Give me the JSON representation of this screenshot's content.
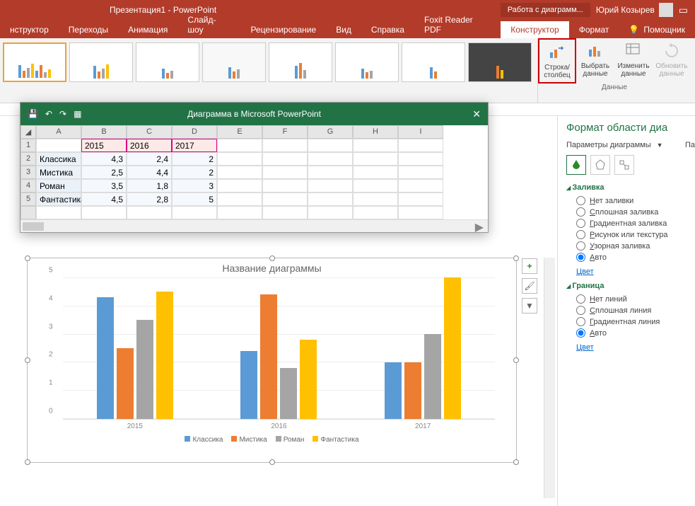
{
  "titlebar": {
    "title": "Презентация1 - PowerPoint",
    "context_tab": "Работа с диаграмм...",
    "user": "Юрий Козырев"
  },
  "ribbon_tabs": {
    "items": [
      "нструктор",
      "Переходы",
      "Анимация",
      "Слайд-шоу",
      "Рецензирование",
      "Вид",
      "Справка",
      "Foxit Reader PDF",
      "Конструктор",
      "Формат"
    ],
    "active_index": 8,
    "helper": "Помощник"
  },
  "ribbon": {
    "data_buttons": [
      {
        "label": "Строка/ столбец",
        "highlighted": true
      },
      {
        "label": "Выбрать данные"
      },
      {
        "label": "Изменить данные"
      },
      {
        "label": "Обновить данные",
        "disabled": true
      }
    ],
    "data_group_label": "Данные"
  },
  "data_window": {
    "title": "Диаграмма в Microsoft PowerPoint",
    "columns": [
      "A",
      "B",
      "C",
      "D",
      "E",
      "F",
      "G",
      "H",
      "I"
    ],
    "rows": [
      {
        "n": "1",
        "cells": [
          "",
          "2015",
          "2016",
          "2017",
          "",
          "",
          "",
          "",
          ""
        ]
      },
      {
        "n": "2",
        "cells": [
          "Классика",
          "4,3",
          "2,4",
          "2",
          "",
          "",
          "",
          "",
          ""
        ]
      },
      {
        "n": "3",
        "cells": [
          "Мистика",
          "2,5",
          "4,4",
          "2",
          "",
          "",
          "",
          "",
          ""
        ]
      },
      {
        "n": "4",
        "cells": [
          "Роман",
          "3,5",
          "1,8",
          "3",
          "",
          "",
          "",
          "",
          ""
        ]
      },
      {
        "n": "5",
        "cells": [
          "Фантастика",
          "4,5",
          "2,8",
          "5",
          "",
          "",
          "",
          "",
          ""
        ]
      }
    ]
  },
  "chart_data": {
    "type": "bar",
    "title": "Название диаграммы",
    "categories": [
      "2015",
      "2016",
      "2017"
    ],
    "series": [
      {
        "name": "Классика",
        "values": [
          4.3,
          2.4,
          2
        ],
        "color": "#5b9bd5"
      },
      {
        "name": "Мистика",
        "values": [
          2.5,
          4.4,
          2
        ],
        "color": "#ed7d31"
      },
      {
        "name": "Роман",
        "values": [
          3.5,
          1.8,
          3
        ],
        "color": "#a5a5a5"
      },
      {
        "name": "Фантастика",
        "values": [
          4.5,
          2.8,
          5
        ],
        "color": "#ffc000"
      }
    ],
    "ylim": [
      0,
      5
    ],
    "yticks": [
      0,
      1,
      2,
      3,
      4,
      5
    ]
  },
  "format_pane": {
    "title": "Формат области диа",
    "params_label": "Параметры диаграммы",
    "extra": "Па",
    "fill": {
      "title": "Заливка",
      "options": [
        "Нет заливки",
        "Сплошная заливка",
        "Градиентная заливка",
        "Рисунок или текстура",
        "Узорная заливка",
        "Авто"
      ],
      "selected": 5,
      "color_label": "Цвет"
    },
    "border": {
      "title": "Граница",
      "options": [
        "Нет линий",
        "Сплошная линия",
        "Градиентная линия",
        "Авто"
      ],
      "selected": 3,
      "color_label": "Цвет"
    }
  }
}
